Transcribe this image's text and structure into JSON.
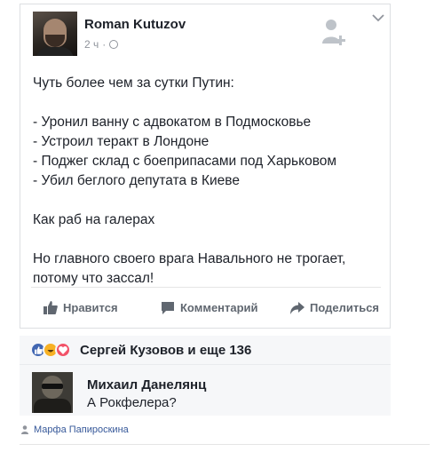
{
  "post": {
    "author": "Roman Kutuzov",
    "time": "2 ч",
    "lines": [
      "Чуть более чем за сутки Путин:",
      "",
      "- Уронил ванну с адвокатом в Подмосковье",
      "- Устроил теракт в Лондоне",
      "- Поджег склад с боеприпасами под Харьковом",
      "- Убил беглого депутата в Киеве",
      "",
      "Как раб на галерах",
      "",
      "Но главного своего врага Навального не трогает,",
      "потому что зассал!"
    ]
  },
  "actions": {
    "like": "Нравится",
    "comment": "Комментарий",
    "share": "Поделиться"
  },
  "reactions": {
    "text": "Сергей Кузовов и еще 136",
    "icons": [
      "like-icon",
      "haha-icon",
      "love-icon"
    ]
  },
  "comment": {
    "author": "Михаил Данелянц",
    "text": "А Рокфелера?"
  },
  "footer": {
    "user": "Марфа Папироскина"
  },
  "colors": {
    "link": "#365899",
    "meta": "#90949c",
    "like": "#4267b2"
  }
}
